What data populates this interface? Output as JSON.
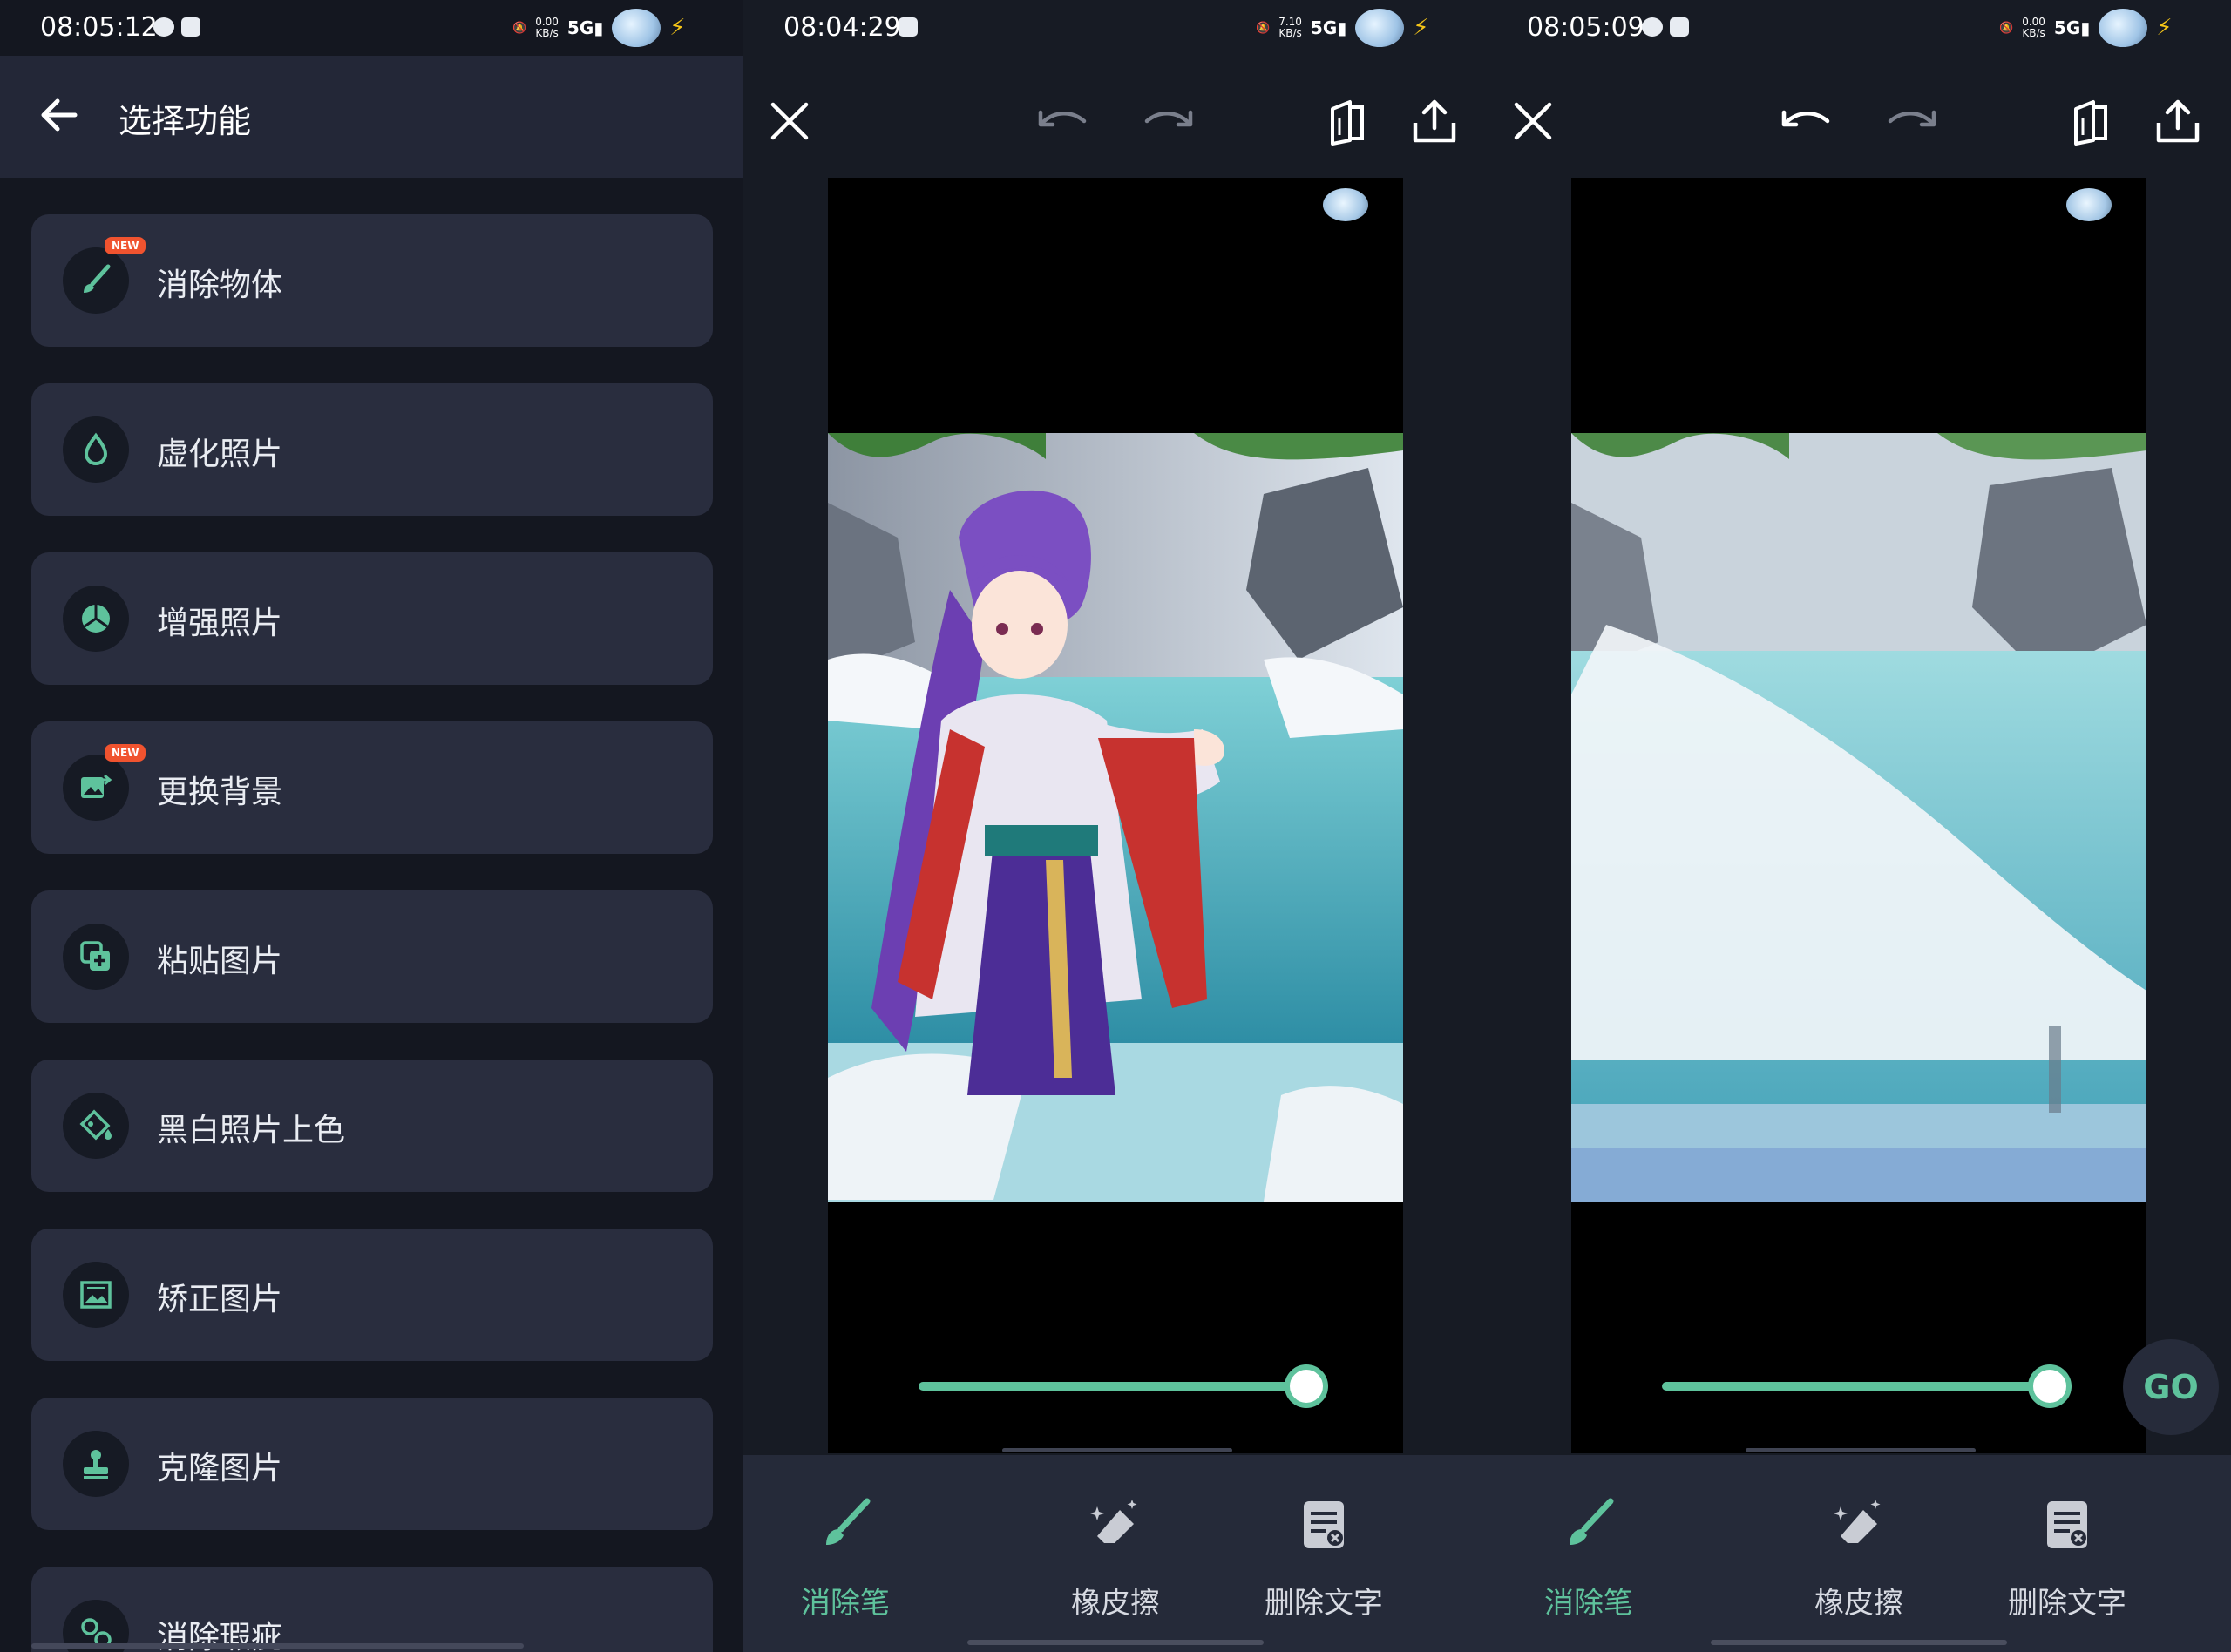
{
  "status_bars": [
    {
      "time": "08:05:12",
      "speed_top": "0.00",
      "speed_unit": "KB/s",
      "network": "5G"
    },
    {
      "time": "08:04:29",
      "speed_top": "7.10",
      "speed_unit": "KB/s",
      "network": "5G"
    },
    {
      "time": "08:05:09",
      "speed_top": "0.00",
      "speed_unit": "KB/s",
      "network": "5G"
    }
  ],
  "menu_screen": {
    "title": "选择功能",
    "items": [
      {
        "label": "消除物体",
        "icon": "brush-icon",
        "badge": "NEW"
      },
      {
        "label": "虚化照片",
        "icon": "droplet-icon",
        "badge": ""
      },
      {
        "label": "增强照片",
        "icon": "enhance-icon",
        "badge": ""
      },
      {
        "label": "更换背景",
        "icon": "image-swap-icon",
        "badge": "NEW"
      },
      {
        "label": "粘贴图片",
        "icon": "paste-image-icon",
        "badge": ""
      },
      {
        "label": "黑白照片上色",
        "icon": "colorize-icon",
        "badge": ""
      },
      {
        "label": "矫正图片",
        "icon": "perspective-icon",
        "badge": ""
      },
      {
        "label": "克隆图片",
        "icon": "stamp-icon",
        "badge": ""
      },
      {
        "label": "消除瑕疵",
        "icon": "blemish-icon",
        "badge": ""
      }
    ]
  },
  "editor": {
    "tools": [
      {
        "label": "消除笔",
        "icon": "brush-icon"
      },
      {
        "label": "橡皮擦",
        "icon": "eraser-icon"
      },
      {
        "label": "删除文字",
        "icon": "delete-text-icon"
      }
    ],
    "brush_size_fraction": 1.0,
    "go_label": "GO",
    "accent": "#5ec29c"
  },
  "colors": {
    "background": "#141720",
    "card": "#292d3e",
    "accent": "#5ec29c",
    "badge": "#f0532f"
  }
}
